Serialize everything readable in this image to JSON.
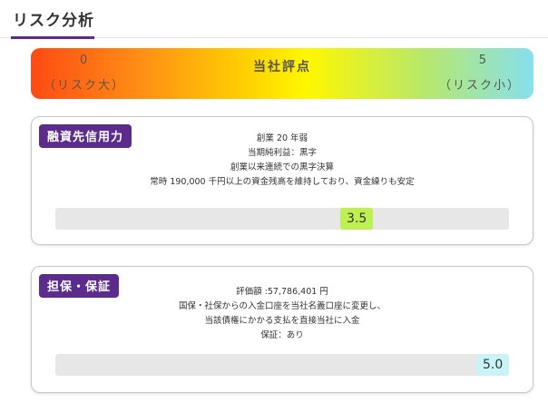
{
  "section": {
    "title": "リスク分析"
  },
  "scale": {
    "low_value": "0",
    "low_label": "（リスク大）",
    "title": "当社評点",
    "high_value": "5",
    "high_label": "（リスク小）",
    "min": 0,
    "max": 5
  },
  "cards": [
    {
      "badge": "融資先信用力",
      "lines": [
        "創業 20 年弱",
        "当期純利益：黒字",
        "創業以来連続での黒字決算",
        "常時 190,000 千円以上の資金残高を維持しており、資金繰りも安定"
      ],
      "score": "3.5",
      "score_value": 3.5
    },
    {
      "badge": "担保・保証",
      "lines": [
        "評価額 :57,786,401 円",
        "国保・社保からの入金口座を当社名義口座に変更し、",
        "当該債権にかかる支払を直接当社に入金",
        "保証：あり"
      ],
      "score": "5.0",
      "score_value": 5.0
    }
  ]
}
